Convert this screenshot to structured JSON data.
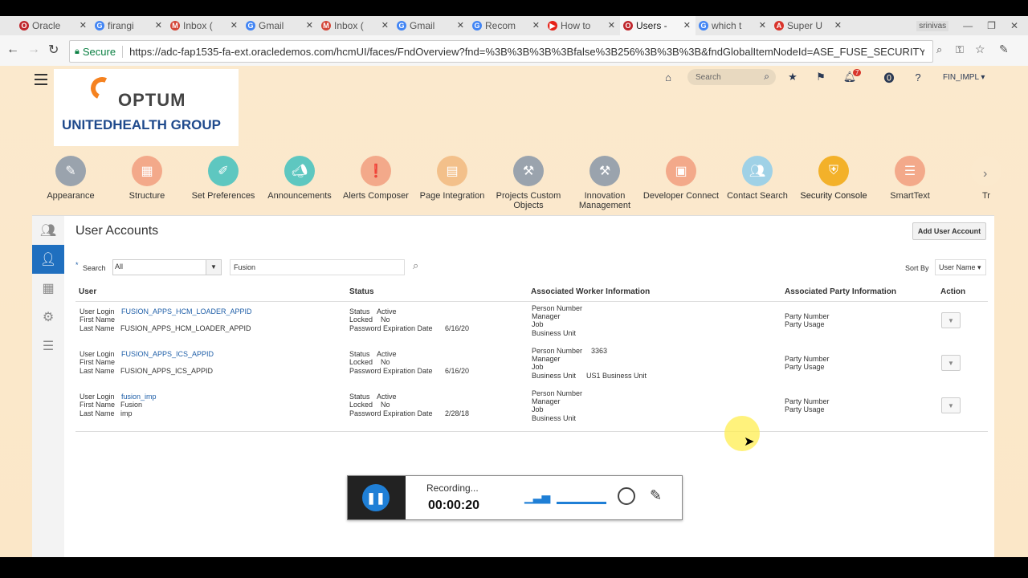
{
  "browser": {
    "tabs": [
      {
        "label": "Oracle",
        "favicon_color": "#c0272d",
        "favicon": "O",
        "active": false
      },
      {
        "label": "firangi",
        "favicon_color": "#4285f4",
        "favicon": "G",
        "active": false
      },
      {
        "label": "Inbox (",
        "favicon_color": "#d44638",
        "favicon": "M",
        "active": false
      },
      {
        "label": "Gmail",
        "favicon_color": "#4285f4",
        "favicon": "G",
        "active": false
      },
      {
        "label": "Inbox (",
        "favicon_color": "#d44638",
        "favicon": "M",
        "active": false
      },
      {
        "label": "Gmail",
        "favicon_color": "#4285f4",
        "favicon": "G",
        "active": false
      },
      {
        "label": "Recom",
        "favicon_color": "#4285f4",
        "favicon": "G",
        "active": false
      },
      {
        "label": "How to",
        "favicon_color": "#e62117",
        "favicon": "▶",
        "active": false
      },
      {
        "label": "Users -",
        "favicon_color": "#c0272d",
        "favicon": "O",
        "active": true
      },
      {
        "label": "which t",
        "favicon_color": "#4285f4",
        "favicon": "G",
        "active": false
      },
      {
        "label": "Super U",
        "favicon_color": "#d9342b",
        "favicon": "A",
        "active": false
      }
    ],
    "profile": "srinivas",
    "secure_label": "Secure",
    "url": "https://adc-fap1535-fa-ext.oracledemos.com/hcmUI/faces/FndOverview?fnd=%3B%3B%3B%3Bfalse%3B256%3B%3B%3B&fndGlobalItemNodeId=ASE_FUSE_SECURITY..."
  },
  "header": {
    "logo_top": "OPTUM",
    "logo_bottom": "UNITEDHEALTH GROUP",
    "search_placeholder": "Search",
    "notification_count": "7",
    "user": "FIN_IMPL ▾"
  },
  "springboard": [
    {
      "label": "Appearance",
      "icon": "brush-icon",
      "color": "#9aa3ad"
    },
    {
      "label": "Structure",
      "icon": "grid-icon",
      "color": "#f3a98a"
    },
    {
      "label": "Set Preferences",
      "icon": "pencil-icon",
      "color": "#5ec7c0"
    },
    {
      "label": "Announcements",
      "icon": "megaphone-icon",
      "color": "#5ec7c0"
    },
    {
      "label": "Alerts Composer",
      "icon": "alert-icon",
      "color": "#f3a98a"
    },
    {
      "label": "Page Integration",
      "icon": "page-icon",
      "color": "#f3c08a"
    },
    {
      "label": "Projects Custom Objects",
      "icon": "tools-icon",
      "color": "#9aa3ad"
    },
    {
      "label": "Innovation Management",
      "icon": "tools-icon",
      "color": "#9aa3ad"
    },
    {
      "label": "Developer Connect",
      "icon": "browser-icon",
      "color": "#f3a98a"
    },
    {
      "label": "Contact Search",
      "icon": "people-icon",
      "color": "#9fd1e6"
    },
    {
      "label": "Security Console",
      "icon": "shield-icon",
      "color": "#f3b12a"
    },
    {
      "label": "SmartText",
      "icon": "text-icon",
      "color": "#f3a98a"
    },
    {
      "label": "Tr",
      "icon": "",
      "color": "#fbe9cd"
    }
  ],
  "panel": {
    "title": "User Accounts",
    "add_button": "Add User Account",
    "search_label": "Search",
    "search_required": "*",
    "search_scope": "All",
    "search_value": "Fusion",
    "sort_label": "Sort By",
    "sort_value": "User Name ▾",
    "columns": [
      "User",
      "Status",
      "Associated Worker Information",
      "Associated Party Information",
      "Action"
    ],
    "field_labels": {
      "user_login": "User Login",
      "first_name": "First Name",
      "last_name": "Last Name",
      "status": "Status",
      "locked": "Locked",
      "pwd_exp": "Password Expiration Date",
      "person_number": "Person Number",
      "manager": "Manager",
      "job": "Job",
      "business_unit": "Business Unit",
      "party_number": "Party Number",
      "party_usage": "Party Usage"
    },
    "rows": [
      {
        "user_login": "FUSION_APPS_HCM_LOADER_APPID",
        "first_name": "",
        "last_name": "FUSION_APPS_HCM_LOADER_APPID",
        "status": "Active",
        "locked": "No",
        "pwd_exp": "6/16/20",
        "person_number": "",
        "manager": "",
        "job": "",
        "business_unit": ""
      },
      {
        "user_login": "FUSION_APPS_ICS_APPID",
        "first_name": "",
        "last_name": "FUSION_APPS_ICS_APPID",
        "status": "Active",
        "locked": "No",
        "pwd_exp": "6/16/20",
        "person_number": "3363",
        "manager": "",
        "job": "",
        "business_unit": "US1 Business Unit"
      },
      {
        "user_login": "fusion_imp",
        "first_name": "Fusion",
        "last_name": "imp",
        "status": "Active",
        "locked": "No",
        "pwd_exp": "2/28/18",
        "person_number": "",
        "manager": "",
        "job": "",
        "business_unit": ""
      }
    ]
  },
  "recorder": {
    "status": "Recording...",
    "time": "00:00:20"
  }
}
